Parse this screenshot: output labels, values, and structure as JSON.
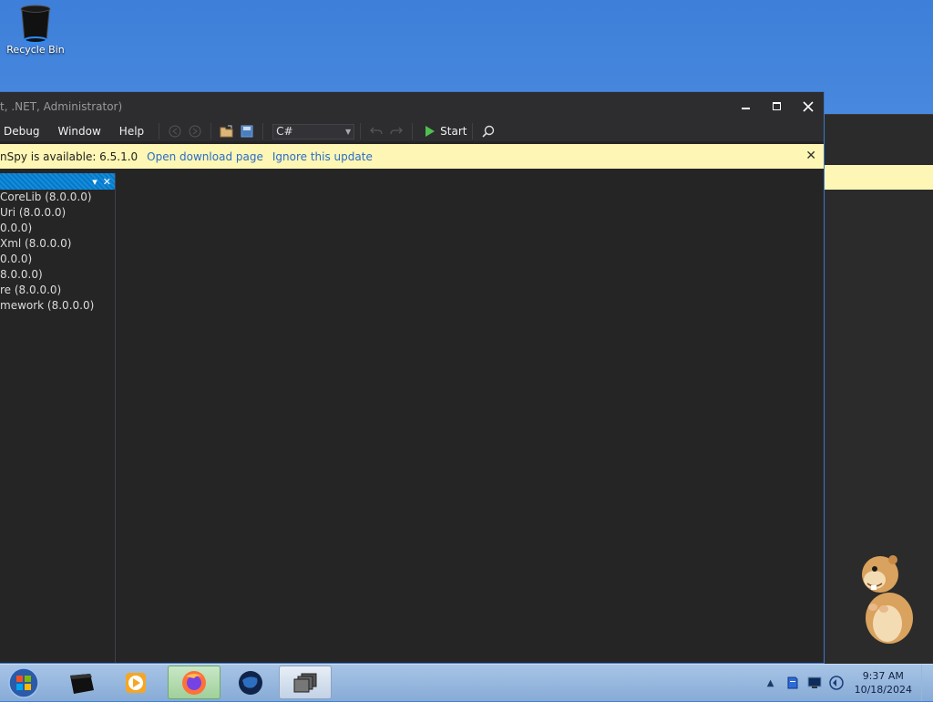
{
  "desktop": {
    "recycle_bin_label": "Recycle Bin"
  },
  "window": {
    "title": "t, .NET, Administrator)",
    "menu": [
      "Debug",
      "Window",
      "Help"
    ],
    "language": "C#",
    "start_label": "Start"
  },
  "infobar": {
    "message": "nSpy is available: 6.5.1.0",
    "open_link": "Open download page",
    "ignore_link": "Ignore this update"
  },
  "assembly_tree": {
    "items": [
      "CoreLib (8.0.0.0)",
      "Uri (8.0.0.0)",
      "0.0.0)",
      "Xml (8.0.0.0)",
      "0.0.0)",
      "8.0.0.0)",
      "re (8.0.0.0)",
      "mework (8.0.0.0)"
    ]
  },
  "taskbar": {
    "time": "9:37 AM",
    "date": "10/18/2024"
  },
  "colors": {
    "accent": "#007acc",
    "infobar_bg": "#fdf6b4",
    "link": "#2a6bc9",
    "window_bg": "#252526"
  }
}
